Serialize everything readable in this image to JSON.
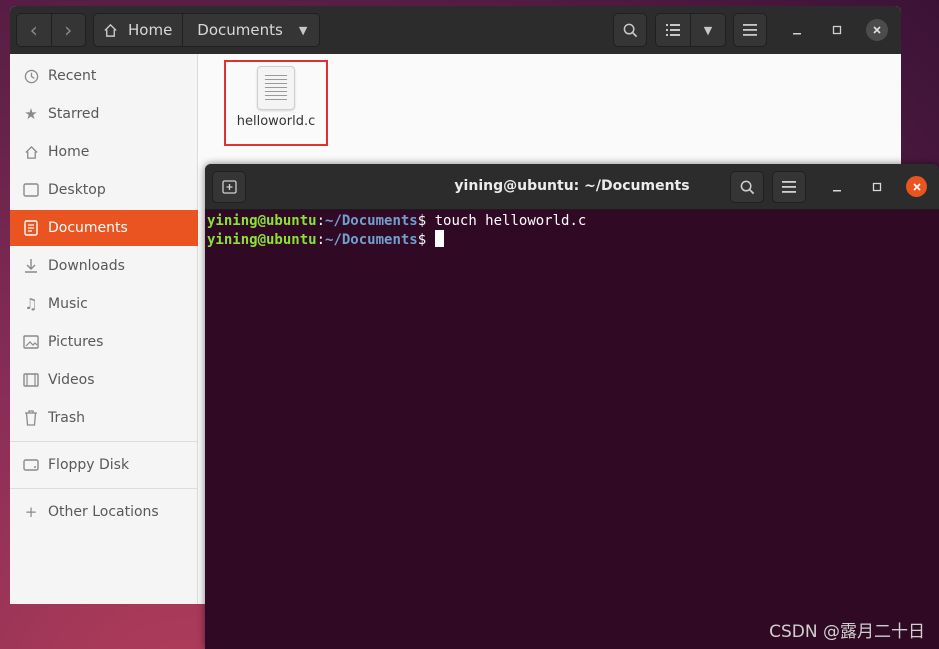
{
  "files": {
    "breadcrumb": {
      "home": "Home",
      "current": "Documents"
    },
    "sidebar": {
      "items": [
        {
          "label": "Recent",
          "icon": "clock-icon"
        },
        {
          "label": "Starred",
          "icon": "star-icon"
        },
        {
          "label": "Home",
          "icon": "home-icon"
        },
        {
          "label": "Desktop",
          "icon": "desktop-icon"
        },
        {
          "label": "Documents",
          "icon": "document-icon",
          "active": true
        },
        {
          "label": "Downloads",
          "icon": "download-icon"
        },
        {
          "label": "Music",
          "icon": "music-icon"
        },
        {
          "label": "Pictures",
          "icon": "picture-icon"
        },
        {
          "label": "Videos",
          "icon": "video-icon"
        },
        {
          "label": "Trash",
          "icon": "trash-icon"
        }
      ],
      "devices": [
        {
          "label": "Floppy Disk",
          "icon": "drive-icon"
        }
      ],
      "other": {
        "label": "Other Locations",
        "icon": "plus-icon"
      }
    },
    "items": [
      {
        "name": "helloworld.c",
        "icon": "text-file-icon"
      }
    ]
  },
  "terminal": {
    "title": "yining@ubuntu: ~/Documents",
    "lines": [
      {
        "user": "yining@ubuntu",
        "sep": ":",
        "path": "~/Documents",
        "prompt": "$",
        "command": " touch helloworld.c"
      },
      {
        "user": "yining@ubuntu",
        "sep": ":",
        "path": "~/Documents",
        "prompt": "$",
        "command": " "
      }
    ]
  },
  "colors": {
    "accent": "#e95420",
    "terminal_bg": "#300a24",
    "prompt_user": "#8ae234",
    "prompt_path": "#729fcf",
    "highlight_box": "#e03131"
  },
  "watermark": "CSDN @露月二十日"
}
